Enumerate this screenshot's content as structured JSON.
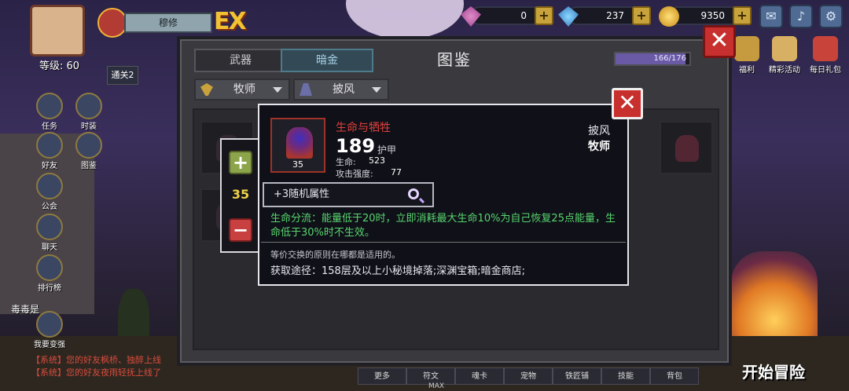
{
  "hud": {
    "player_name": "穆修",
    "level": "等级: 60",
    "ex_badge": "EX",
    "stage_label": "通关2",
    "currencies": [
      {
        "icon": "pink-gem-icon",
        "value": "0"
      },
      {
        "icon": "blue-diamond-icon",
        "value": "237"
      },
      {
        "icon": "gold-coin-icon",
        "value": "9350"
      }
    ],
    "right_icons": [
      {
        "label": "福利"
      },
      {
        "label": "精彩活动"
      },
      {
        "label": "每日礼包"
      }
    ]
  },
  "left_menu": [
    {
      "label": "任务"
    },
    {
      "label": "时装"
    },
    {
      "label": "好友"
    },
    {
      "label": "图鉴"
    },
    {
      "label": "公会"
    },
    {
      "label": "聊天"
    },
    {
      "label": "排行榜"
    },
    {
      "label": "我要变强"
    }
  ],
  "codex_menu_label": "图鉴",
  "left_name": "毒毒是",
  "chat": [
    {
      "prefix": "【系统】",
      "text": "您的好友枫桥、独醉上线"
    },
    {
      "prefix": "【系统】",
      "text": "您的好友夜雨轻抚上线了"
    }
  ],
  "panel": {
    "title": "图鉴",
    "tabs": [
      "武器",
      "暗金"
    ],
    "active_tab": 1,
    "progress_text": "166/176",
    "progress_fraction": 0.943,
    "filter_class": "牧师",
    "filter_type": "披风"
  },
  "popup": {
    "item_name": "生命与牺牲",
    "item_level": "35",
    "armor_value": "189",
    "armor_label": "护甲",
    "stats": [
      {
        "label": "生命:",
        "value": "523"
      },
      {
        "label": "攻击强度:",
        "value": "77"
      }
    ],
    "item_type": "披风",
    "item_class": "牧师",
    "random_attr": "+3随机属性",
    "effect": "生命分流：能量低于20时，立即消耗最大生命10%为自己恢复25点能量，生命低于30%时不生效。",
    "flavor": "等价交换的原则在哪都是适用的。",
    "source": "获取途径：158层及以上小秘境掉落;深渊宝箱;暗金商店;",
    "quantity": "35"
  },
  "bottom_tabs": [
    "更多",
    "符文",
    "魂卡",
    "宠物",
    "铁匠铺",
    "技能",
    "背包"
  ],
  "max_label": "MAX",
  "start_button": "开始冒险",
  "colors": {
    "item_name": "#e0413c",
    "effect_text": "#58d66e",
    "close_red": "#c8302e",
    "quantity_gold": "#f0d24a"
  }
}
